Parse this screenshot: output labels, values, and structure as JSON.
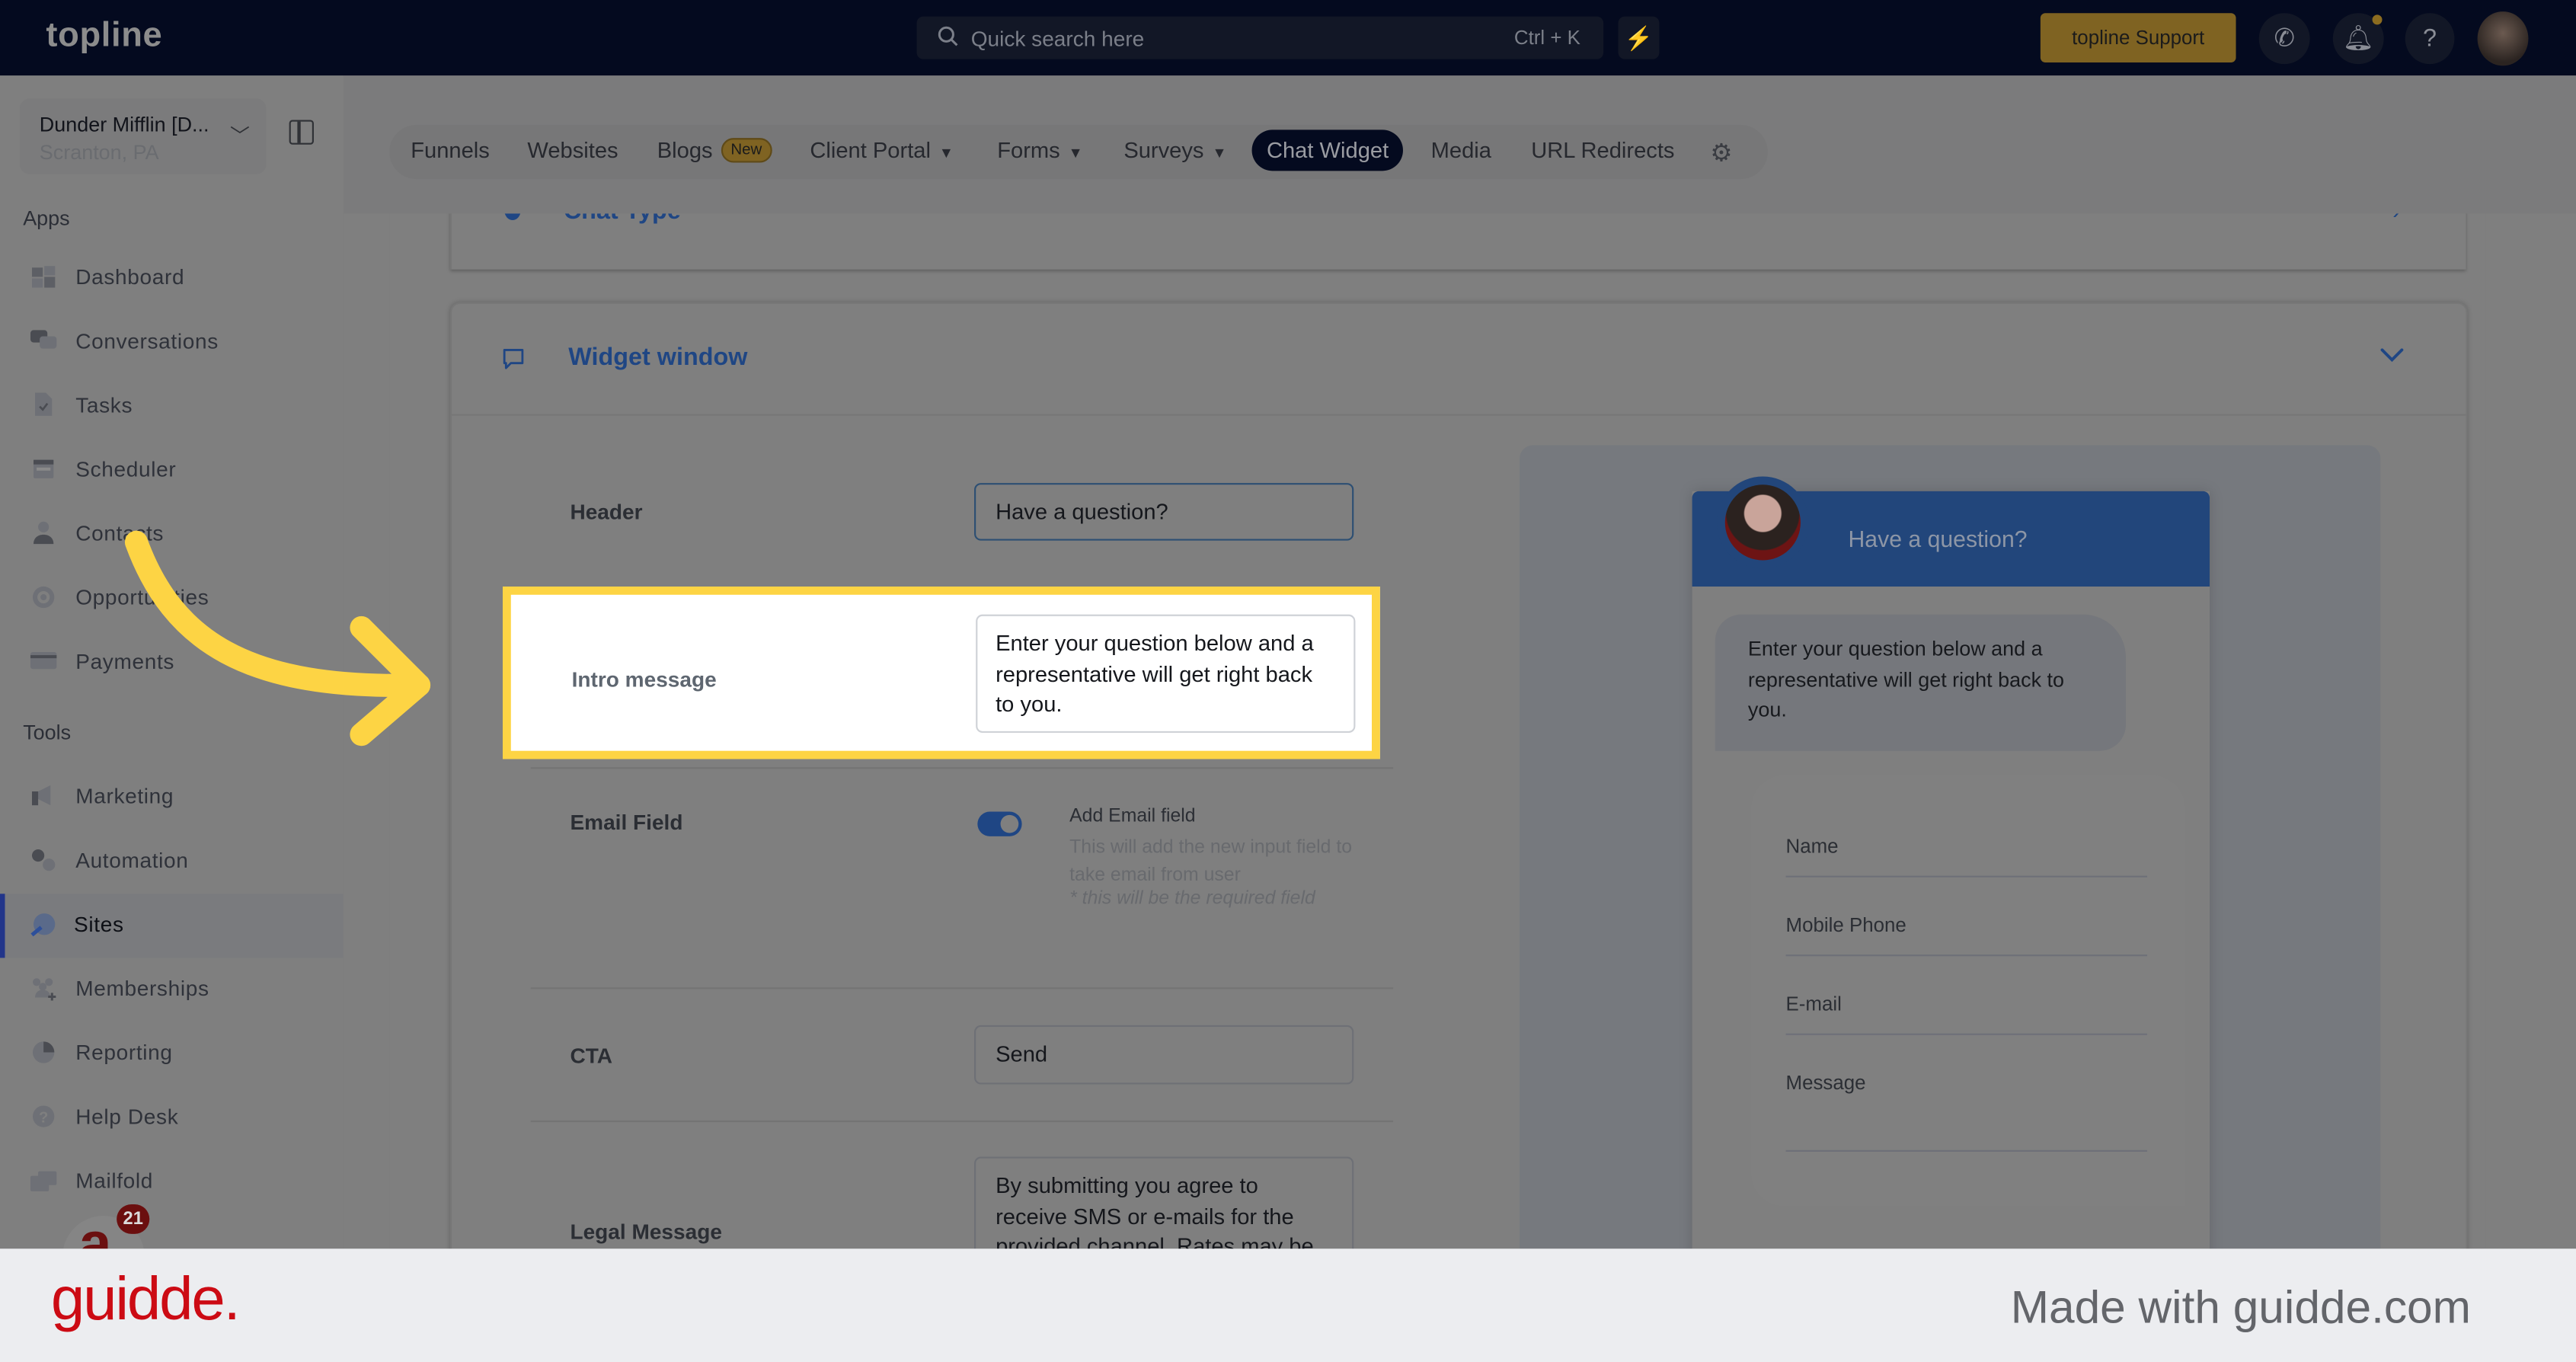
{
  "app": {
    "logo": "topline",
    "search_placeholder": "Quick search here",
    "search_shortcut": "Ctrl + K",
    "support_label": "topline Support"
  },
  "sidebar": {
    "location_name": "Dunder Mifflin [D...",
    "location_city": "Scranton, PA",
    "apps_label": "Apps",
    "tools_label": "Tools",
    "apps": [
      {
        "label": "Dashboard",
        "icon": "dashboard-icon"
      },
      {
        "label": "Conversations",
        "icon": "chat-bubbles-icon"
      },
      {
        "label": "Tasks",
        "icon": "task-file-icon"
      },
      {
        "label": "Scheduler",
        "icon": "calendar-icon"
      },
      {
        "label": "Contacts",
        "icon": "person-icon"
      },
      {
        "label": "Opportunities",
        "icon": "target-icon"
      },
      {
        "label": "Payments",
        "icon": "credit-card-icon"
      }
    ],
    "tools": [
      {
        "label": "Marketing",
        "icon": "megaphone-icon"
      },
      {
        "label": "Automation",
        "icon": "gears-icon"
      },
      {
        "label": "Sites",
        "icon": "globe-cursor-icon",
        "active": true
      },
      {
        "label": "Memberships",
        "icon": "users-plus-icon"
      },
      {
        "label": "Reporting",
        "icon": "pie-chart-icon"
      },
      {
        "label": "Help Desk",
        "icon": "question-circle-icon"
      },
      {
        "label": "Mailfold",
        "icon": "mail-icon"
      }
    ],
    "notification_count": "21"
  },
  "tabs": [
    {
      "label": "Funnels"
    },
    {
      "label": "Websites"
    },
    {
      "label": "Blogs",
      "badge": "New"
    },
    {
      "label": "Client Portal",
      "dropdown": true
    },
    {
      "label": "Forms",
      "dropdown": true
    },
    {
      "label": "Surveys",
      "dropdown": true
    },
    {
      "label": "Chat Widget",
      "active": true
    },
    {
      "label": "Media"
    },
    {
      "label": "URL Redirects"
    }
  ],
  "sections": {
    "chat_type_title": "Chat Type",
    "widget_window_title": "Widget window"
  },
  "form": {
    "header_label": "Header",
    "header_value": "Have a question?",
    "intro_label": "Intro message",
    "intro_value": "Enter your question below and a representative will get right back to you.",
    "email_label": "Email Field",
    "email_toggle_on": true,
    "email_toggle_title": "Add Email field",
    "email_toggle_desc": "This will add the new input field to take email from user",
    "email_toggle_note": "* this will be the required field",
    "cta_label": "CTA",
    "cta_value": "Send",
    "legal_label": "Legal Message",
    "legal_value": "By submitting you agree to receive SMS or e-mails for the provided channel. Rates may be"
  },
  "preview": {
    "header_title": "Have a question?",
    "intro_message": "Enter your question below and a representative will get right back to you.",
    "fields": [
      "Name",
      "Mobile Phone",
      "E-mail",
      "Message"
    ]
  },
  "footer": {
    "brand": "guidde.",
    "made_with": "Made with guidde.com"
  },
  "colors": {
    "highlight": "#fdd444",
    "accent_blue": "#1f4684",
    "topbar": "#040a1f",
    "brand_red": "#cc0b14"
  }
}
